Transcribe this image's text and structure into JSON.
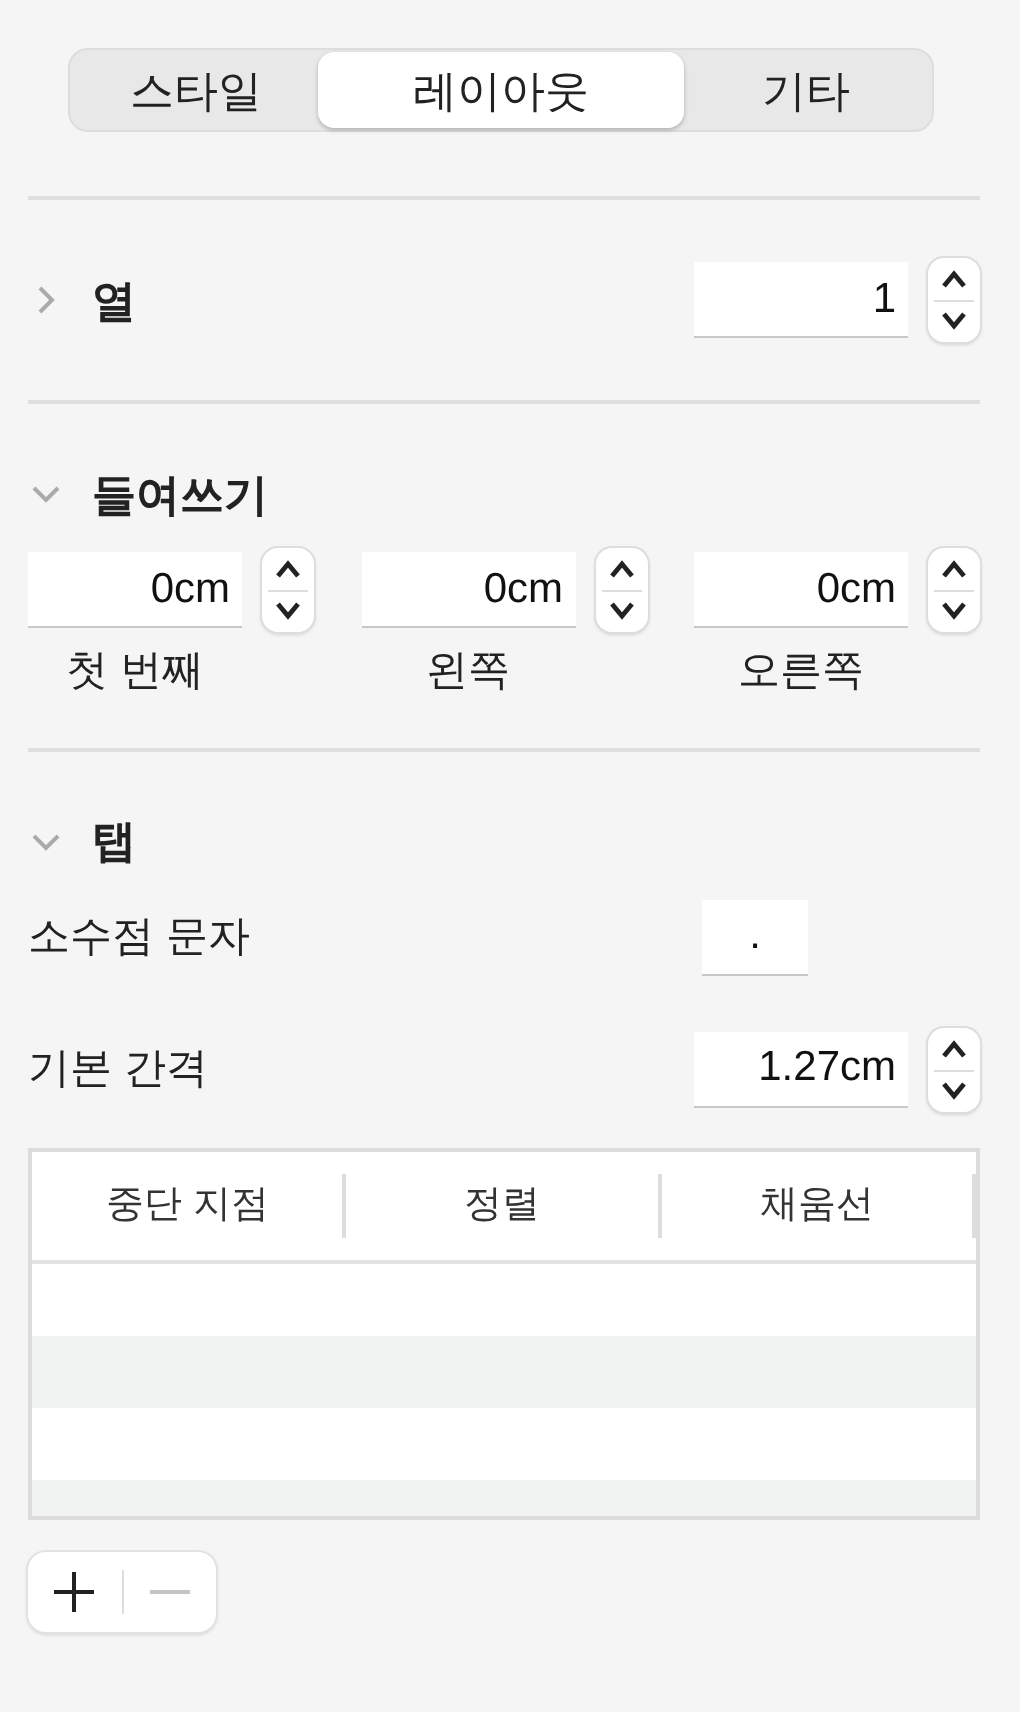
{
  "tabs": [
    {
      "label": "스타일",
      "selected": false
    },
    {
      "label": "레이아웃",
      "selected": true
    },
    {
      "label": "기타",
      "selected": false
    }
  ],
  "columns": {
    "title": "열",
    "expanded": false,
    "value": "1"
  },
  "indents": {
    "title": "들여쓰기",
    "expanded": true,
    "fields": [
      {
        "value": "0cm",
        "label": "첫 번째"
      },
      {
        "value": "0cm",
        "label": "왼쪽"
      },
      {
        "value": "0cm",
        "label": "오른쪽"
      }
    ]
  },
  "tab_stops": {
    "title": "탭",
    "expanded": true,
    "decimal_label": "소수점 문자",
    "decimal_value": ".",
    "spacing_label": "기본 간격",
    "spacing_value": "1.27cm",
    "table": {
      "columns": [
        "중단 지점",
        "정렬",
        "채움선"
      ]
    },
    "add_button": {
      "disabled": false
    },
    "remove_button": {
      "disabled": true
    }
  }
}
